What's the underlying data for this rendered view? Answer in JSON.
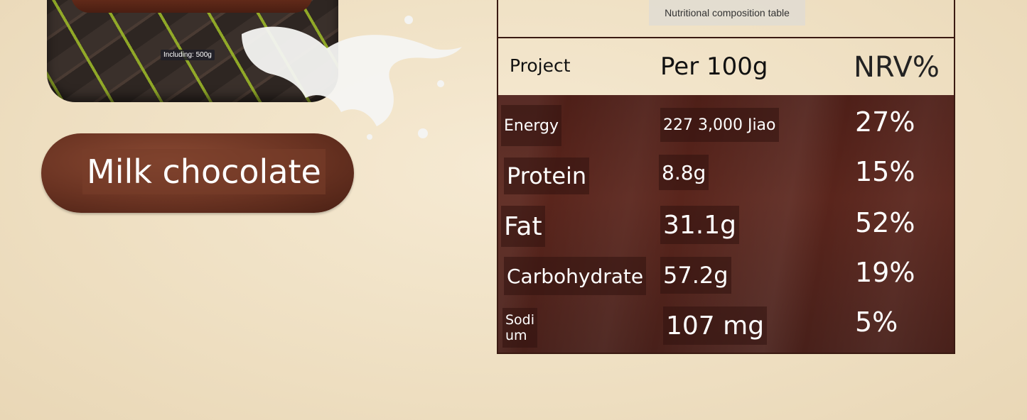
{
  "product": {
    "including_label": "Including: 500g",
    "name": "Milk chocolate"
  },
  "table": {
    "caption": "Nutritional composition table",
    "headers": {
      "project": "Project",
      "per": "Per 100g",
      "nrv": "NRV%"
    },
    "rows": [
      {
        "item": "Energy",
        "per": "227 3,000 Jiao",
        "nrv": "27%"
      },
      {
        "item": "Protein",
        "per": "8.8g",
        "nrv": "15%"
      },
      {
        "item": "Fat",
        "per": "31.1g",
        "nrv": "52%"
      },
      {
        "item": "Carbohydrate",
        "per": "57.2g",
        "nrv": "19%"
      },
      {
        "item": "Sodi\num",
        "per": "107 mg",
        "nrv": "5%"
      }
    ]
  }
}
